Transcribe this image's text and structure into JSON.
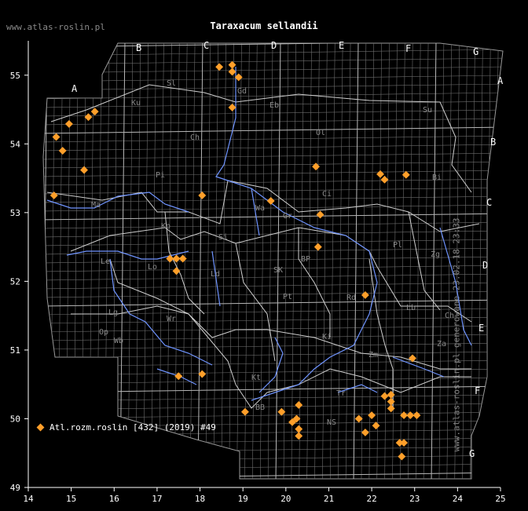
{
  "title": "Taraxacum sellandii",
  "site_label": "www.atlas-roslin.pl",
  "generated_label": "www.atlas-roslin.pl generowane 23.02.18 23:33",
  "legend_label": "Atl.rozm.roslin [432] (2019) #49",
  "marker_color": "#ff9f2a",
  "x_ticks": [
    "14",
    "15",
    "16",
    "17",
    "18",
    "19",
    "20",
    "21",
    "22",
    "23",
    "24",
    "25"
  ],
  "y_ticks": [
    "55",
    "54",
    "53",
    "52",
    "51",
    "50",
    "49"
  ],
  "column_letters": [
    "A",
    "B",
    "C",
    "D",
    "E",
    "F",
    "G"
  ],
  "row_letters": [
    "A",
    "B",
    "C",
    "D",
    "E",
    "F",
    "G"
  ],
  "region_labels": [
    "Sl",
    "Ku",
    "Gd",
    "Eb",
    "Su",
    "Ch",
    "Ol",
    "Pi",
    "Bi",
    "Ci",
    "Wa",
    "Gr",
    "Ma",
    "Ko",
    "Si",
    "Pl",
    "Zg",
    "Le",
    "Lo",
    "BP",
    "Ld",
    "SK",
    "Pt",
    "Rd",
    "Lb",
    "Ch",
    "Lg",
    "Wr",
    "Wb",
    "Op",
    "Ki",
    "Za",
    "Kt",
    "Tr",
    "Zm",
    "BB",
    "NS"
  ],
  "chart_data": {
    "type": "scatter",
    "title": "Taraxacum sellandii",
    "xlim": [
      14,
      25
    ],
    "ylim": [
      49,
      55.5
    ],
    "points": [
      [
        18.45,
        55.12
      ],
      [
        18.75,
        55.15
      ],
      [
        18.75,
        55.05
      ],
      [
        18.9,
        54.97
      ],
      [
        15.55,
        54.47
      ],
      [
        15.4,
        54.39
      ],
      [
        14.95,
        54.29
      ],
      [
        14.65,
        54.1
      ],
      [
        14.8,
        53.9
      ],
      [
        15.3,
        53.62
      ],
      [
        14.6,
        53.25
      ],
      [
        18.75,
        54.53
      ],
      [
        20.7,
        53.67
      ],
      [
        22.2,
        53.56
      ],
      [
        22.3,
        53.48
      ],
      [
        22.8,
        53.55
      ],
      [
        18.05,
        53.25
      ],
      [
        19.65,
        53.17
      ],
      [
        20.8,
        52.97
      ],
      [
        20.75,
        52.5
      ],
      [
        17.3,
        52.33
      ],
      [
        17.45,
        52.33
      ],
      [
        17.6,
        52.33
      ],
      [
        17.45,
        52.15
      ],
      [
        21.85,
        51.8
      ],
      [
        22.95,
        50.88
      ],
      [
        17.5,
        50.62
      ],
      [
        18.05,
        50.65
      ],
      [
        19.05,
        50.1
      ],
      [
        19.9,
        50.1
      ],
      [
        20.3,
        50.2
      ],
      [
        20.25,
        50.0
      ],
      [
        20.15,
        49.95
      ],
      [
        20.3,
        49.85
      ],
      [
        20.3,
        49.75
      ],
      [
        21.7,
        50.0
      ],
      [
        22.0,
        50.05
      ],
      [
        21.85,
        49.8
      ],
      [
        22.1,
        49.9
      ],
      [
        22.3,
        50.33
      ],
      [
        22.45,
        50.35
      ],
      [
        22.45,
        50.25
      ],
      [
        22.45,
        50.15
      ],
      [
        22.75,
        50.05
      ],
      [
        22.9,
        50.05
      ],
      [
        23.05,
        50.05
      ],
      [
        22.65,
        49.65
      ],
      [
        22.75,
        49.65
      ],
      [
        22.7,
        49.45
      ]
    ]
  }
}
